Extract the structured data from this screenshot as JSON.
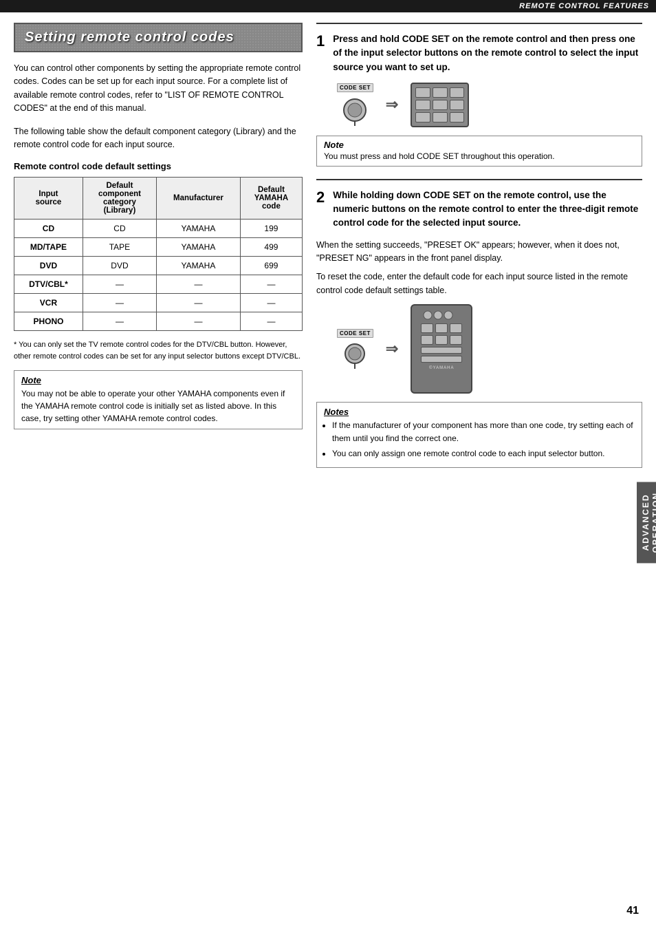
{
  "header": {
    "title": "REMOTE CONTROL FEATURES"
  },
  "page_number": "41",
  "side_tab": {
    "line1": "ADVANCED",
    "line2": "OPERATION"
  },
  "left": {
    "section_title": "Setting remote control codes",
    "intro_paragraphs": [
      "You can control other components by setting the appropriate remote control codes. Codes can be set up for each input source. For a complete list of available remote control codes, refer to \"LIST OF REMOTE CONTROL CODES\" at the end of this manual.",
      "The following table show the default component category (Library) and the remote control code for each input source."
    ],
    "table_heading": "Remote control code default settings",
    "table": {
      "headers": [
        "Input source",
        "Default component category (Library)",
        "Manufacturer",
        "Default YAMAHA code"
      ],
      "rows": [
        [
          "CD",
          "CD",
          "YAMAHA",
          "199"
        ],
        [
          "MD/TAPE",
          "TAPE",
          "YAMAHA",
          "499"
        ],
        [
          "DVD",
          "DVD",
          "YAMAHA",
          "699"
        ],
        [
          "DTV/CBL*",
          "—",
          "—",
          "—"
        ],
        [
          "VCR",
          "—",
          "—",
          "—"
        ],
        [
          "PHONO",
          "—",
          "—",
          "—"
        ]
      ]
    },
    "footnote": "* You can only set the TV remote control codes for the DTV/CBL button. However, other remote control codes can be set for any input selector buttons except DTV/CBL.",
    "note_label": "Note",
    "note_text": "You may not be able to operate your other YAMAHA components even if the YAMAHA remote control code is initially set as listed above. In this case, try setting other YAMAHA remote control codes."
  },
  "right": {
    "step1": {
      "number": "1",
      "text": "Press and hold CODE SET on the remote control and then press one of the input selector buttons on the remote control to select the input source you want to set up.",
      "note_label": "Note",
      "note_text": "You must press and hold CODE SET throughout this operation."
    },
    "step2": {
      "number": "2",
      "text": "While holding down CODE SET on the remote control, use the numeric buttons on the remote control to enter the three-digit remote control code for the selected input source.",
      "body1": "When the setting succeeds, \"PRESET OK\" appears; however, when it does not, \"PRESET NG\" appears in the front panel display.",
      "body2": "To reset the code, enter the default code for each input source listed in the remote control code default settings table.",
      "notes_label": "Notes",
      "notes": [
        "If the manufacturer of your component has more than one code, try setting each of them until you find the correct one.",
        "You can only assign one remote control code to each input selector button."
      ]
    },
    "code_set_label": "CODE SET",
    "yamaha_label": "©YAMAHA"
  }
}
